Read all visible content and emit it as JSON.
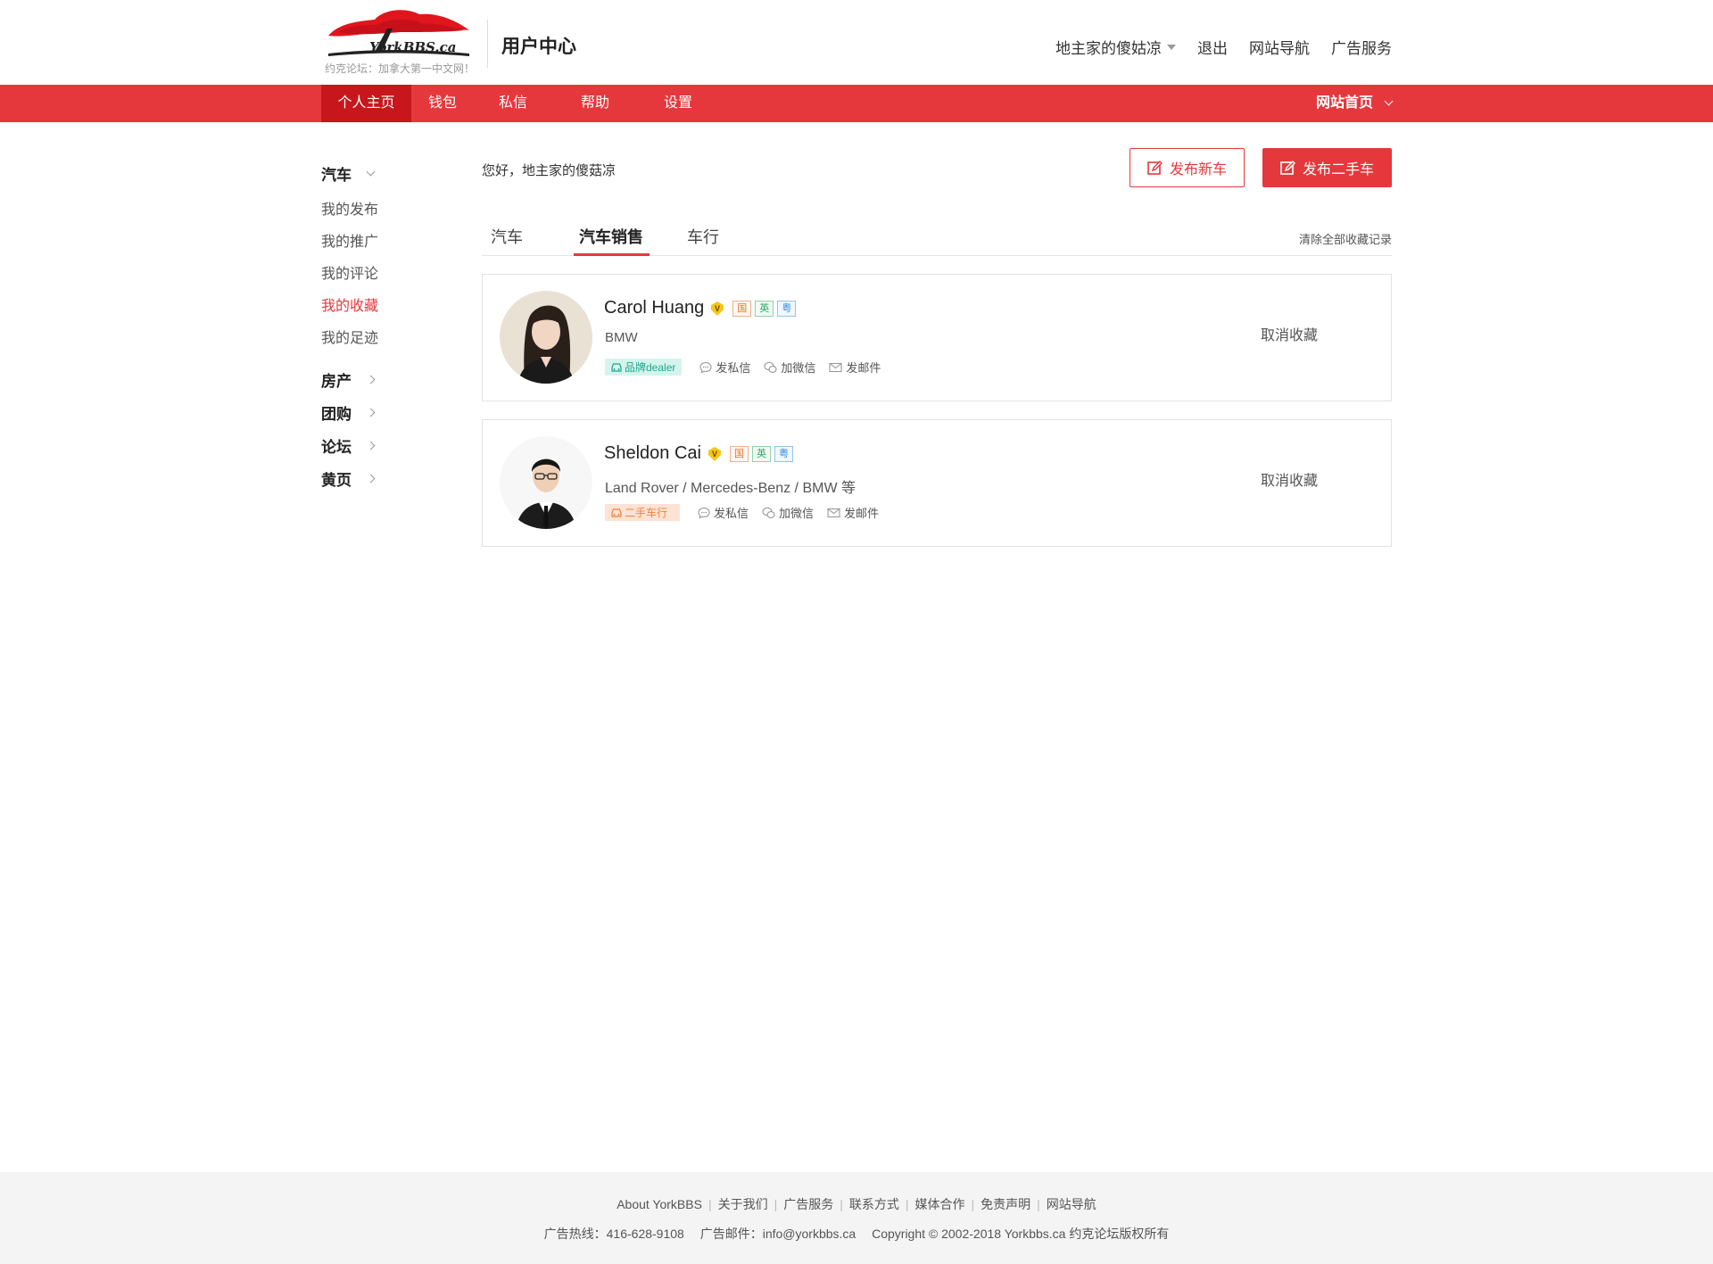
{
  "header": {
    "logo_text": "YorkBBS.ca",
    "slogan": "约克论坛：加拿大第一中文网！",
    "title": "用户中心",
    "username": "地主家的傻姑凉",
    "logout": "退出",
    "site_nav": "网站导航",
    "ad_service": "广告服务"
  },
  "navbar": {
    "items": [
      "个人主页",
      "钱包",
      "私信",
      "帮助",
      "设置"
    ],
    "active_index": 0,
    "home": "网站首页"
  },
  "sidebar": {
    "car": {
      "title": "汽车",
      "links": [
        "我的发布",
        "我的推广",
        "我的评论",
        "我的收藏",
        "我的足迹"
      ],
      "active_index": 3
    },
    "others": [
      "房产",
      "团购",
      "论坛",
      "黄页"
    ]
  },
  "main": {
    "greeting": "您好，地主家的傻菇凉",
    "btn_new_car": "发布新车",
    "btn_used_car": "发布二手车",
    "tabs": [
      "汽车",
      "汽车销售",
      "车行"
    ],
    "active_tab": 1,
    "clear_all": "清除全部收藏记录",
    "cards": [
      {
        "name": "Carol Huang",
        "langs": [
          "国",
          "英",
          "粤"
        ],
        "brand": "BMW",
        "tag": "品牌dealer",
        "tag_type": "dealer",
        "actions": [
          "发私信",
          "加微信",
          "发邮件"
        ],
        "unfav": "取消收藏"
      },
      {
        "name": "Sheldon Cai",
        "langs": [
          "国",
          "英",
          "粤"
        ],
        "brand": "Land Rover / Mercedes-Benz / BMW 等",
        "tag": "二手车行",
        "tag_type": "used",
        "actions": [
          "发私信",
          "加微信",
          "发邮件"
        ],
        "unfav": "取消收藏"
      }
    ]
  },
  "footer": {
    "links": [
      "About YorkBBS",
      "关于我们",
      "广告服务",
      "联系方式",
      "媒体合作",
      "免责声明",
      "网站导航"
    ],
    "hotline": "广告热线：416-628-9108",
    "email": "广告邮件：info@yorkbbs.ca",
    "copyright": "Copyright © 2002-2018 Yorkbbs.ca 约克论坛版权所有"
  },
  "colors": {
    "brand_red": "#e5383c",
    "nav_active": "#c8161d",
    "dealer_tag": "#1ea88a",
    "used_tag": "#f0803e"
  }
}
